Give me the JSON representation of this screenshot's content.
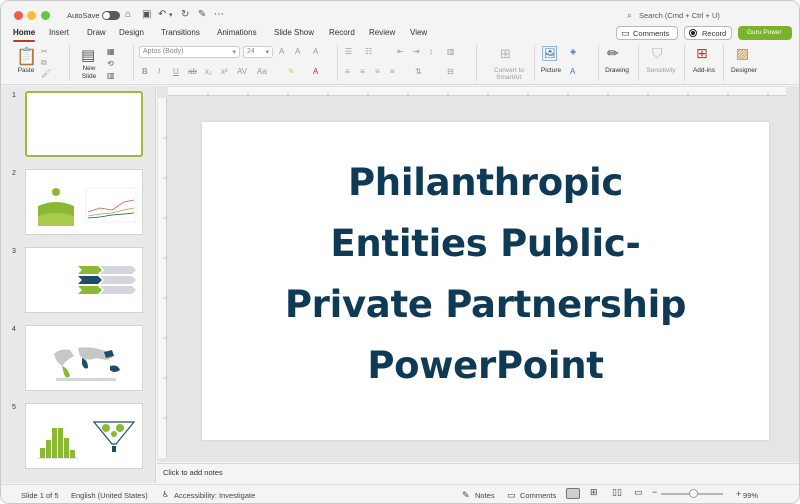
{
  "titlebar": {
    "autosave_label": "AutoSave",
    "search_placeholder": "Search (Cmd + Ctrl + U)"
  },
  "tabs": [
    "Home",
    "Insert",
    "Draw",
    "Design",
    "Transitions",
    "Animations",
    "Slide Show",
    "Record",
    "Review",
    "View"
  ],
  "header_buttons": {
    "comments": "Comments",
    "record": "Record",
    "guru": "Guru Power"
  },
  "ribbon": {
    "paste": "Paste",
    "new_slide": "New\nSlide",
    "font_name": "Aptos (Body)",
    "font_size": "24",
    "convert_smartart": "Convert to\nSmartArt",
    "picture": "Picture",
    "drawing": "Drawing",
    "sensitivity": "Sensitivity",
    "addins": "Add-ins",
    "designer": "Designer"
  },
  "slides": [
    {
      "number": "1",
      "selected": true
    },
    {
      "number": "2"
    },
    {
      "number": "3"
    },
    {
      "number": "4"
    },
    {
      "number": "5"
    }
  ],
  "slide": {
    "title": "Philanthropic\nEntities Public-\nPrivate Partnership\nPowerPoint"
  },
  "notes_placeholder": "Click to add notes",
  "status": {
    "slide_of": "Slide 1 of 5",
    "language": "English (United States)",
    "accessibility": "Accessibility: Investigate",
    "notes": "Notes",
    "comments": "Comments",
    "zoom": "99%"
  },
  "colors": {
    "accent": "#c0392b",
    "guru": "#7bb32e",
    "title": "#0f3a55",
    "thumb_green": "#8db833",
    "thumb_navy": "#1e4d6b"
  }
}
